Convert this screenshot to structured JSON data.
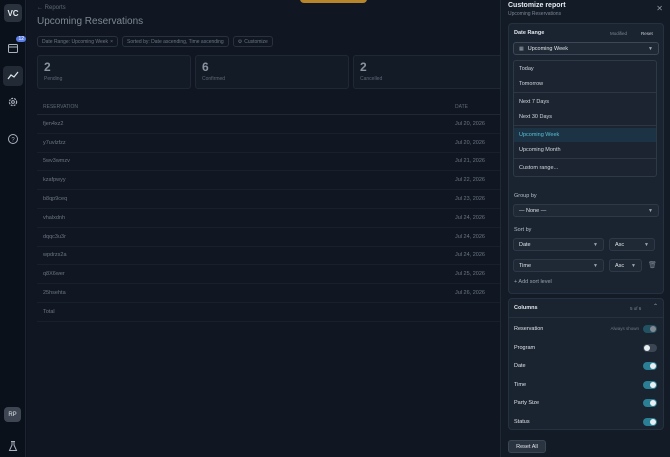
{
  "rail": {
    "logo_text": "VC",
    "badge_count": "12",
    "avatar_initials": "RP"
  },
  "main": {
    "breadcrumb": "← Reports",
    "title": "Upcoming Reservations",
    "filters": {
      "date_range": "Date Range: Upcoming Week",
      "sorted_by": "Sorted by: Date ascending, Time ascending",
      "customize": "Customize"
    },
    "stats": [
      {
        "value": "2",
        "label": "Pending"
      },
      {
        "value": "6",
        "label": "Confirmed"
      },
      {
        "value": "2",
        "label": "Cancelled"
      }
    ],
    "table": {
      "headers": [
        "Reservation",
        "Date"
      ],
      "rows": [
        {
          "id": "fjen4xz2",
          "date": "Jul 20, 2026"
        },
        {
          "id": "y7uvlzfzz",
          "date": "Jul 20, 2026"
        },
        {
          "id": "5wv3wmzv",
          "date": "Jul 21, 2026"
        },
        {
          "id": "kzafpwyy",
          "date": "Jul 22, 2026"
        },
        {
          "id": "b8qp9ceq",
          "date": "Jul 23, 2026"
        },
        {
          "id": "vhalxdnh",
          "date": "Jul 24, 2026"
        },
        {
          "id": "dqqc3u3r",
          "date": "Jul 24, 2026"
        },
        {
          "id": "wpdrzs2a",
          "date": "Jul 24, 2026"
        },
        {
          "id": "q8X6wer",
          "date": "Jul 25, 2026"
        },
        {
          "id": "25hsehta",
          "date": "Jul 26, 2026"
        }
      ],
      "total_label": "Total"
    }
  },
  "panel": {
    "title": "Customize report",
    "subtitle": "Upcoming Reservations",
    "date_range": {
      "title": "Date Range",
      "modified": "Modified",
      "reset": "Reset",
      "value": "Upcoming Week",
      "options": [
        "Today",
        "Tomorrow",
        "Next 7 Days",
        "Next 30 Days",
        "Upcoming Week",
        "Upcoming Month",
        "Custom range..."
      ],
      "selected": "Upcoming Week"
    },
    "group_by": {
      "label": "Group by",
      "value": "— None —"
    },
    "sort_by": {
      "label": "Sort by",
      "levels": [
        {
          "field": "Date",
          "order": "Asc"
        },
        {
          "field": "Time",
          "order": "Asc"
        }
      ],
      "add_level": "+ Add sort level"
    },
    "columns": {
      "title": "Columns",
      "count": "5 of 6",
      "always_shown": "Always shown",
      "items": [
        {
          "name": "Reservation",
          "on": true
        },
        {
          "name": "Program",
          "on": false
        },
        {
          "name": "Date",
          "on": true
        },
        {
          "name": "Time",
          "on": true
        },
        {
          "name": "Party Size",
          "on": true
        },
        {
          "name": "Status",
          "on": true
        }
      ]
    },
    "reset_all": "Reset All"
  },
  "colors": {
    "accent": "#2b7f94",
    "selected_text": "#56c2d6",
    "warning_pill": "#b8862a"
  }
}
